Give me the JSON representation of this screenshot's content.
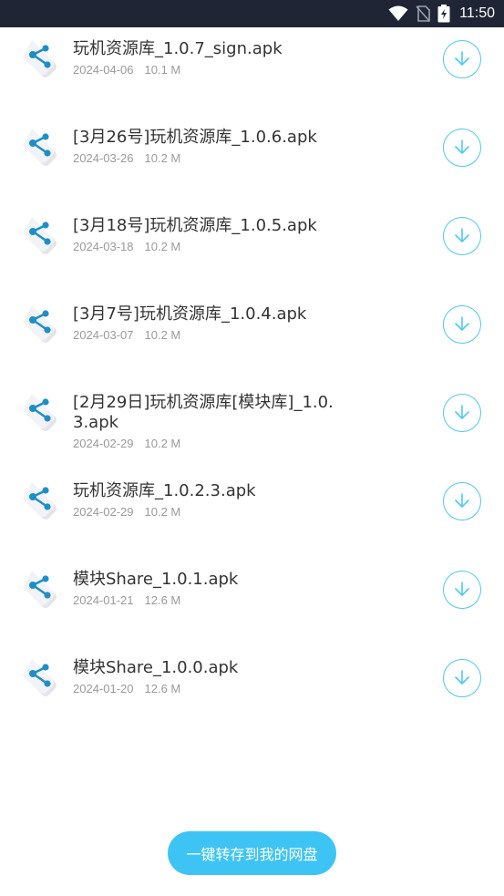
{
  "status_bar": {
    "time": "11:50"
  },
  "files": [
    {
      "name": "玩机资源库_1.0.7_sign.apk",
      "date": "2024-04-06",
      "size": "10.1 M"
    },
    {
      "name": "[3月26号]玩机资源库_1.0.6.apk",
      "date": "2024-03-26",
      "size": "10.2 M"
    },
    {
      "name": "[3月18号]玩机资源库_1.0.5.apk",
      "date": "2024-03-18",
      "size": "10.2 M"
    },
    {
      "name": "[3月7号]玩机资源库_1.0.4.apk",
      "date": "2024-03-07",
      "size": "10.2 M"
    },
    {
      "name": "[2月29日]玩机资源库[模块库]_1.0.3.apk",
      "date": "2024-02-29",
      "size": "10.2 M"
    },
    {
      "name": "玩机资源库_1.0.2.3.apk",
      "date": "2024-02-29",
      "size": "10.2 M"
    },
    {
      "name": "模块Share_1.0.1.apk",
      "date": "2024-01-21",
      "size": "12.6 M"
    },
    {
      "name": "模块Share_1.0.0.apk",
      "date": "2024-01-20",
      "size": "12.6 M"
    }
  ],
  "save_button_label": "一键转存到我的网盘",
  "colors": {
    "accent": "#3ec4f4",
    "outline": "#4fc8ee",
    "status_bar": "#1f2535"
  },
  "icons": {
    "file": "share-file-icon",
    "download": "download-arrow-icon"
  }
}
